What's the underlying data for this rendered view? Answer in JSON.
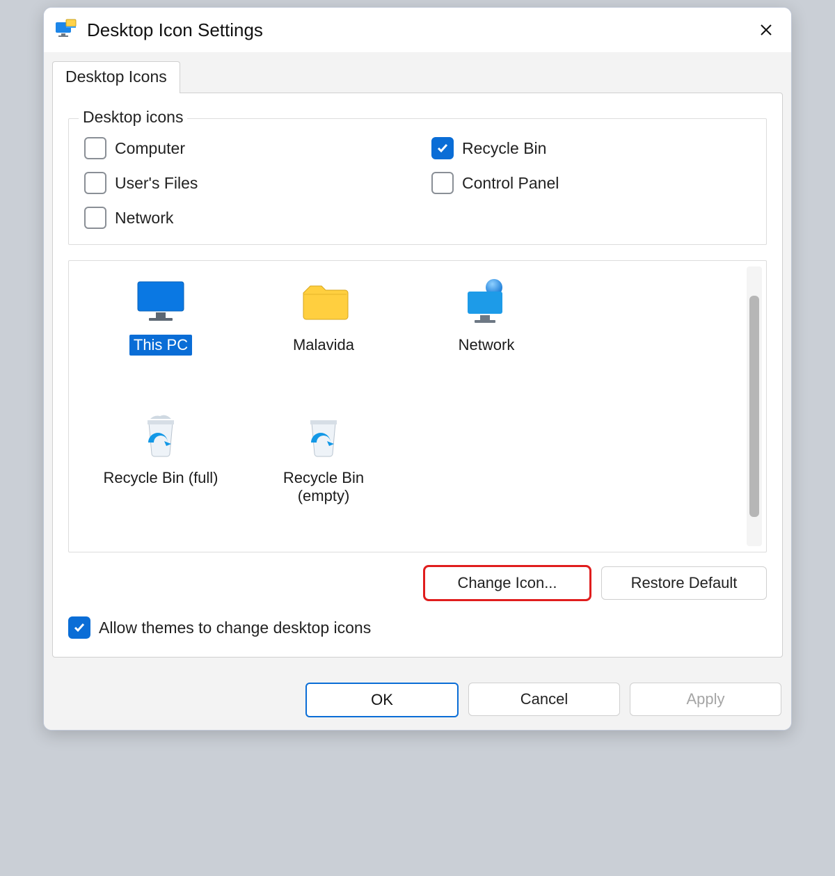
{
  "window": {
    "title": "Desktop Icon Settings"
  },
  "tabs": {
    "active": "Desktop Icons"
  },
  "fieldset": {
    "legend": "Desktop icons",
    "checkboxes": [
      {
        "id": "computer",
        "label": "Computer",
        "checked": false
      },
      {
        "id": "recyclebin",
        "label": "Recycle Bin",
        "checked": true
      },
      {
        "id": "usersfiles",
        "label": "User's Files",
        "checked": false
      },
      {
        "id": "controlpanel",
        "label": "Control Panel",
        "checked": false
      },
      {
        "id": "network",
        "label": "Network",
        "checked": false
      }
    ]
  },
  "preview": {
    "items": [
      {
        "id": "thispc",
        "label": "This PC",
        "selected": true
      },
      {
        "id": "userfolder",
        "label": "Malavida",
        "selected": false
      },
      {
        "id": "network",
        "label": "Network",
        "selected": false
      },
      {
        "id": "recyclebin_full",
        "label": "Recycle Bin (full)",
        "selected": false
      },
      {
        "id": "recyclebin_empty",
        "label": "Recycle Bin (empty)",
        "selected": false
      }
    ]
  },
  "buttons": {
    "change_icon": "Change Icon...",
    "restore_default": "Restore Default",
    "ok": "OK",
    "cancel": "Cancel",
    "apply": "Apply"
  },
  "allow_themes": {
    "label": "Allow themes to change desktop icons",
    "checked": true
  },
  "colors": {
    "accent": "#0a6dd6",
    "highlight": "#e01d1d"
  }
}
